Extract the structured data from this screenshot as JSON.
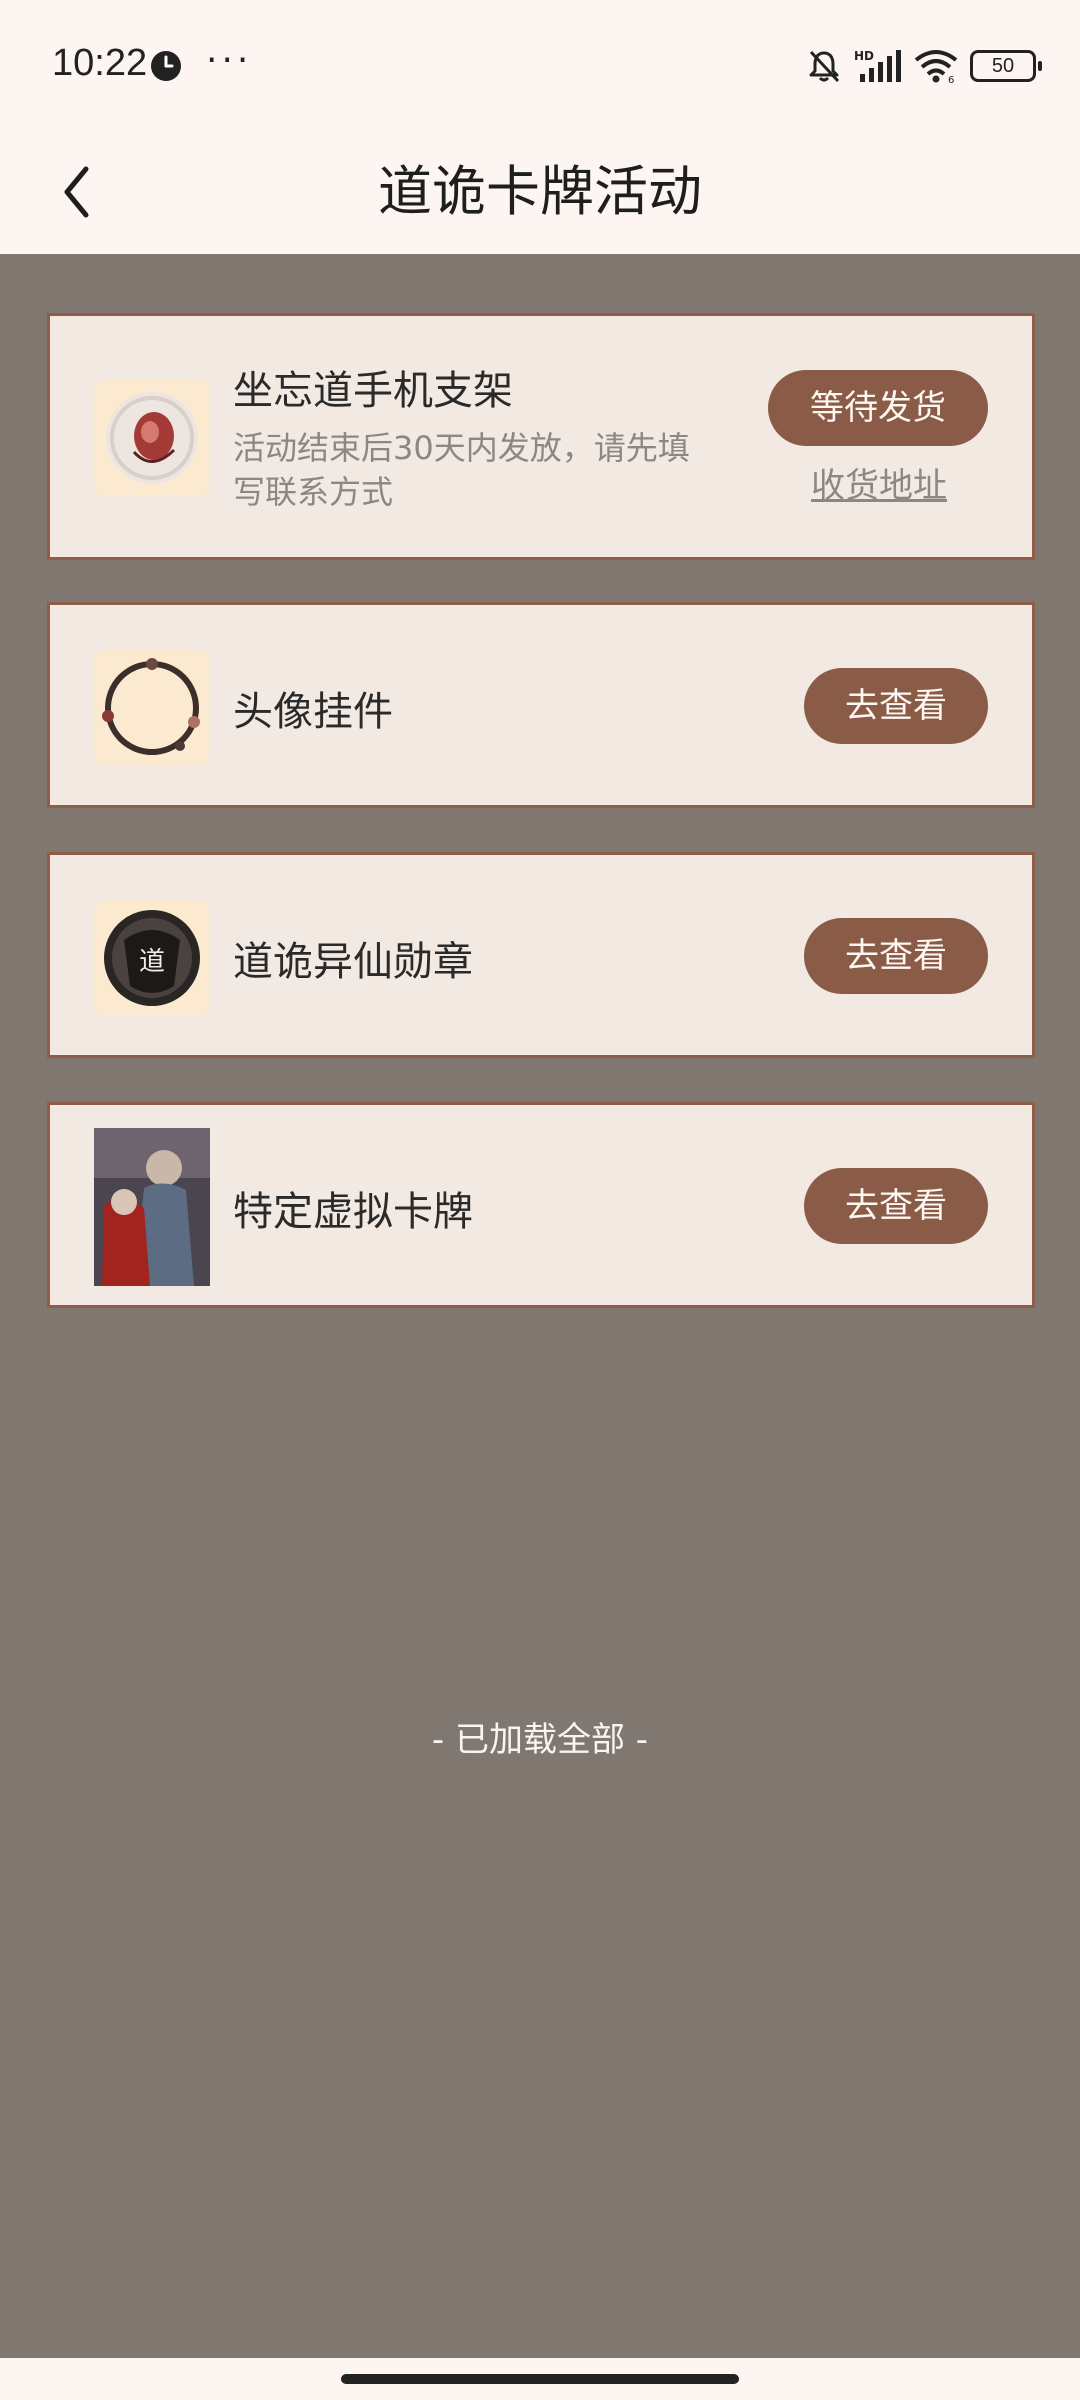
{
  "status": {
    "time": "10:22",
    "more": "···",
    "battery": "50"
  },
  "header": {
    "title": "道诡卡牌活动"
  },
  "items": [
    {
      "title": "坐忘道手机支架",
      "desc": "活动结束后30天内发放，请先填写联系方式",
      "button": "等待发货",
      "link": "收货地址"
    },
    {
      "title": "头像挂件",
      "button": "去查看"
    },
    {
      "title": "道诡异仙勋章",
      "button": "去查看"
    },
    {
      "title": "特定虚拟卡牌",
      "button": "去查看"
    }
  ],
  "footer": {
    "note": "- 已加载全部 -"
  }
}
